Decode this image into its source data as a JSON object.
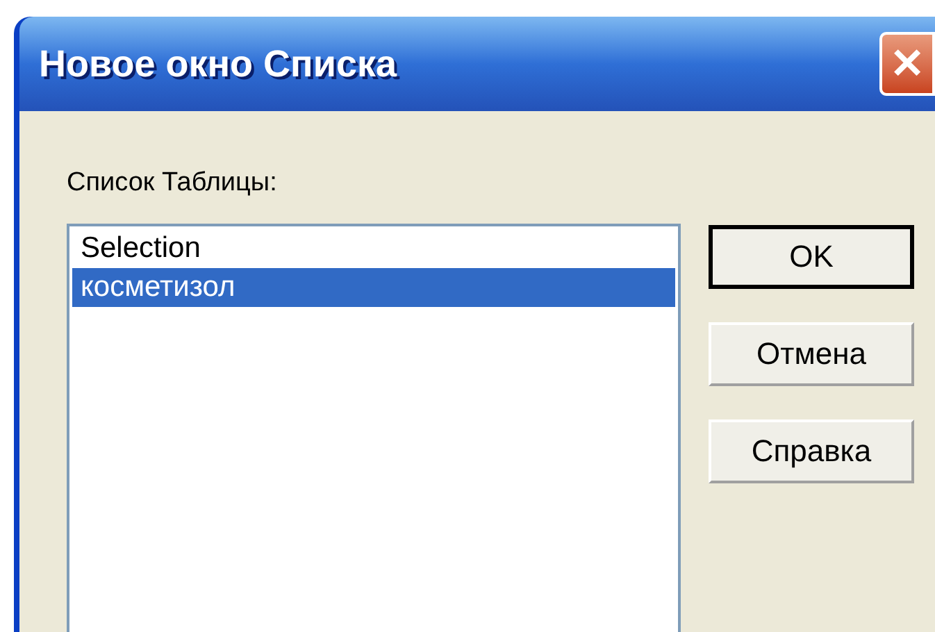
{
  "window": {
    "title": "Новое окно Списка",
    "close_glyph": "✕"
  },
  "list_label": "Список Таблицы:",
  "list_items": [
    {
      "label": "Selection",
      "selected": false
    },
    {
      "label": "косметизол",
      "selected": true
    }
  ],
  "buttons": [
    {
      "label": "OK",
      "default": true
    },
    {
      "label": "Отмена",
      "default": false
    },
    {
      "label": "Справка",
      "default": false
    }
  ]
}
